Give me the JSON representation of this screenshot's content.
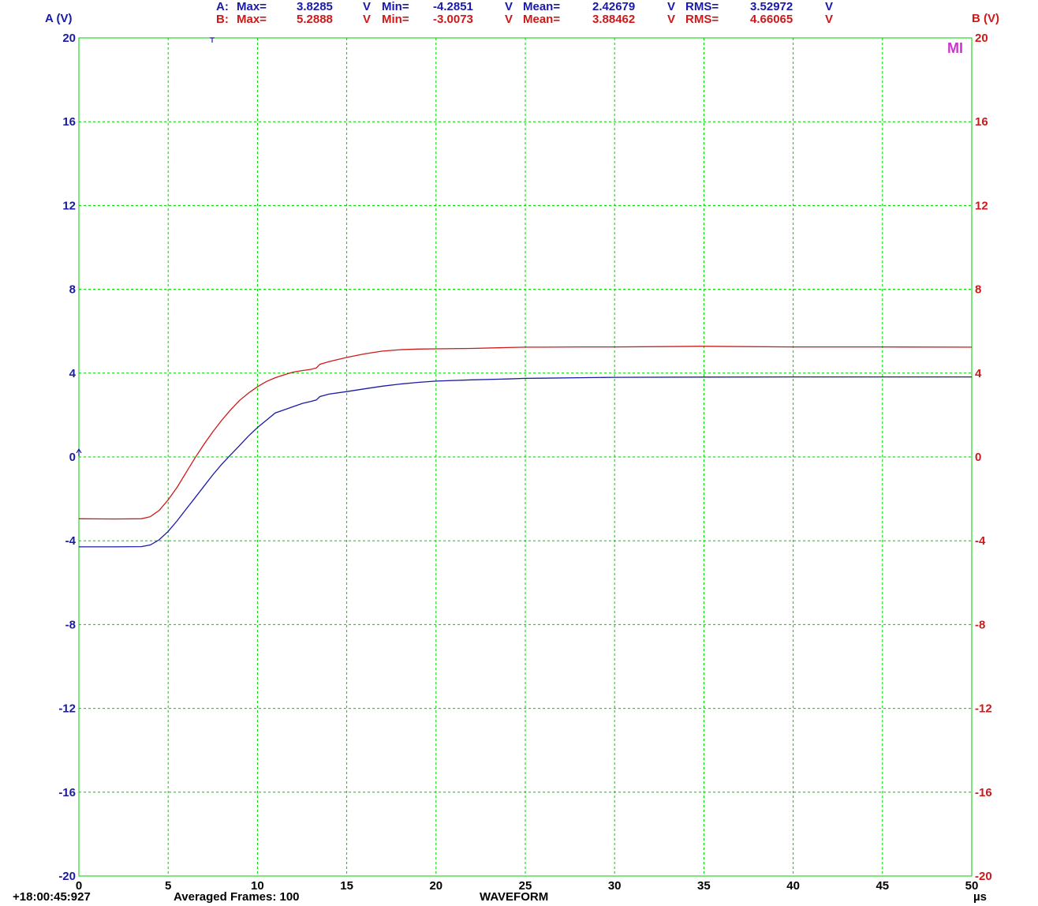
{
  "colors": {
    "channel_a": "#1a1aa8",
    "channel_b": "#cc1a1a",
    "grid": "#00cc00",
    "marker": "#cc33cc",
    "text": "#000000"
  },
  "header": {
    "a_axis_label": "A (V)",
    "b_axis_label": "B (V)",
    "stats": [
      {
        "channel": "A:",
        "max_label": "Max=",
        "max": "3.8285",
        "max_unit": "V",
        "min_label": "Min=",
        "min": "-4.2851",
        "min_unit": "V",
        "mean_label": "Mean=",
        "mean": "2.42679",
        "mean_unit": "V",
        "rms_label": "RMS=",
        "rms": "3.52972",
        "rms_unit": "V"
      },
      {
        "channel": "B:",
        "max_label": "Max=",
        "max": "5.2888",
        "max_unit": "V",
        "min_label": "Min=",
        "min": "-3.0073",
        "min_unit": "V",
        "mean_label": "Mean=",
        "mean": "3.88462",
        "mean_unit": "V",
        "rms_label": "RMS=",
        "rms": "4.66065",
        "rms_unit": "V"
      }
    ]
  },
  "marker_label": "MI",
  "footer": {
    "timestamp": "+18:00:45:927",
    "frames": "Averaged Frames: 100",
    "mode": "WAVEFORM"
  },
  "chart_data": {
    "type": "line",
    "xlim": [
      0,
      50
    ],
    "ylim": [
      -20,
      20
    ],
    "y2lim": [
      -20,
      20
    ],
    "x_unit": "µs",
    "grid": true,
    "x_ticks": [
      "0",
      "5",
      "10",
      "15",
      "20",
      "25",
      "30",
      "35",
      "40",
      "45",
      "50"
    ],
    "y_ticks": [
      "20",
      "16",
      "12",
      "8",
      "4",
      "0",
      "-4",
      "-8",
      "-12",
      "-16",
      "-20"
    ],
    "series": [
      {
        "name": "A",
        "axis": "left",
        "x": [
          0,
          2,
          3.5,
          4,
          4.5,
          5,
          5.5,
          6,
          6.5,
          7,
          7.5,
          8,
          8.5,
          9,
          9.5,
          10,
          10.5,
          11,
          11.5,
          12,
          12.5,
          13,
          13.3,
          13.5,
          14,
          15,
          16,
          17,
          18,
          19,
          20,
          22,
          24,
          25,
          26,
          28,
          30,
          35,
          40,
          45,
          50
        ],
        "y": [
          -4.29,
          -4.29,
          -4.28,
          -4.2,
          -3.95,
          -3.55,
          -3.05,
          -2.5,
          -1.95,
          -1.4,
          -0.85,
          -0.35,
          0.1,
          0.55,
          1.0,
          1.4,
          1.75,
          2.1,
          2.25,
          2.4,
          2.55,
          2.65,
          2.72,
          2.88,
          3.0,
          3.12,
          3.25,
          3.38,
          3.48,
          3.56,
          3.62,
          3.68,
          3.72,
          3.75,
          3.76,
          3.78,
          3.8,
          3.81,
          3.82,
          3.82,
          3.82
        ]
      },
      {
        "name": "B",
        "axis": "right",
        "x": [
          0,
          2,
          3.5,
          4,
          4.5,
          5,
          5.5,
          6,
          6.5,
          7,
          7.5,
          8,
          8.5,
          9,
          9.5,
          10,
          10.5,
          11,
          11.5,
          12,
          12.5,
          13,
          13.3,
          13.5,
          14,
          15,
          16,
          17,
          18,
          19,
          20,
          22,
          24,
          25,
          26,
          28,
          30,
          35,
          40,
          45,
          50
        ],
        "y": [
          -2.95,
          -2.96,
          -2.95,
          -2.85,
          -2.55,
          -2.05,
          -1.45,
          -0.75,
          -0.05,
          0.6,
          1.2,
          1.75,
          2.25,
          2.7,
          3.05,
          3.35,
          3.6,
          3.78,
          3.92,
          4.05,
          4.12,
          4.18,
          4.25,
          4.42,
          4.55,
          4.75,
          4.92,
          5.05,
          5.12,
          5.15,
          5.16,
          5.18,
          5.22,
          5.24,
          5.24,
          5.25,
          5.25,
          5.28,
          5.25,
          5.25,
          5.24
        ]
      }
    ]
  }
}
